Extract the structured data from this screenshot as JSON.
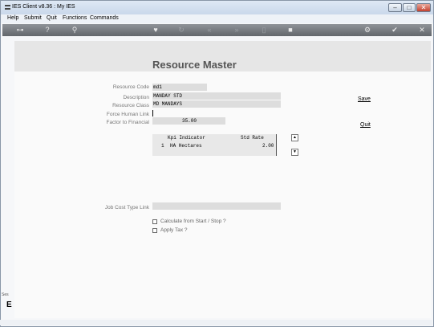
{
  "window": {
    "title": "IES Client v8.36 : My IES",
    "controls": {
      "minimize": "–",
      "maximize": "□",
      "close": "✕"
    }
  },
  "menu": [
    "Help",
    "Submit",
    "Quit",
    "Functions",
    "Commands"
  ],
  "toolbar": {
    "icons": [
      "key-icon",
      "help-icon",
      "search-icon",
      "heart-icon",
      "refresh-icon",
      "rewind-icon",
      "fast-forward-icon",
      "document-icon",
      "stop-icon",
      "settings-icon",
      "check-icon",
      "close-icon"
    ]
  },
  "form": {
    "title": "Resource Master",
    "fields": {
      "resource_code": {
        "label": "Resource Code",
        "value": "md1"
      },
      "description": {
        "label": "Description",
        "value": "MANDAY STD"
      },
      "resource_class": {
        "label": "Resource Class",
        "value": "MD MANDAYS"
      },
      "force_human_link": {
        "label": "Force Human Link",
        "value": ""
      },
      "factor_to_financial": {
        "label": "Factor to Financial",
        "value": "35.00"
      },
      "job_cost_type_link": {
        "label": "Job Cost Type Link",
        "value": ""
      }
    },
    "grid": {
      "columns": [
        "Kpi Indicator",
        "Std Rate"
      ],
      "rows": [
        {
          "index": "1",
          "kpi": "HA Hectares",
          "rate": "2.00"
        }
      ]
    },
    "checkboxes": {
      "calculate": {
        "label": "Calculate from Start / Stop ?",
        "checked": false
      },
      "apply_tax": {
        "label": "Apply Tax ?",
        "checked": false
      }
    },
    "actions": {
      "save": "Save",
      "quit": "Quit"
    }
  },
  "sidebar": {
    "text": "Ses",
    "glyph": "E"
  }
}
